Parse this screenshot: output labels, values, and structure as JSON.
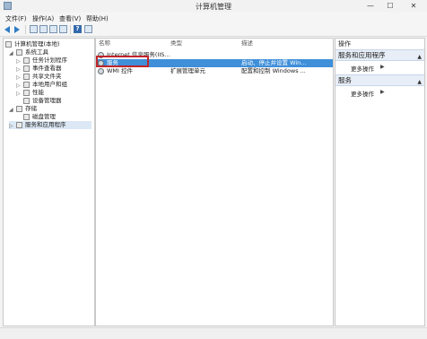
{
  "window": {
    "title": "计算机管理"
  },
  "window_controls": {
    "minimize": "—",
    "maximize": "☐",
    "close": "✕"
  },
  "menu": [
    "文件(F)",
    "操作(A)",
    "查看(V)",
    "帮助(H)"
  ],
  "tree": [
    {
      "label": "计算机管理(本地)",
      "indent": 0,
      "expander": ""
    },
    {
      "label": "系统工具",
      "indent": 1,
      "expander": "◢"
    },
    {
      "label": "任务计划程序",
      "indent": 2,
      "expander": "▷"
    },
    {
      "label": "事件查看器",
      "indent": 2,
      "expander": "▷"
    },
    {
      "label": "共享文件夹",
      "indent": 2,
      "expander": "▷"
    },
    {
      "label": "本地用户和组",
      "indent": 2,
      "expander": "▷"
    },
    {
      "label": "性能",
      "indent": 2,
      "expander": "▷"
    },
    {
      "label": "设备管理器",
      "indent": 2,
      "expander": ""
    },
    {
      "label": "存储",
      "indent": 1,
      "expander": "◢"
    },
    {
      "label": "磁盘管理",
      "indent": 2,
      "expander": ""
    },
    {
      "label": "服务和应用程序",
      "indent": 1,
      "expander": "▷"
    }
  ],
  "columns": [
    "名称",
    "类型",
    "描述"
  ],
  "rows": [
    {
      "name": "Internet 信息服务(IIS...",
      "type": "",
      "desc": ""
    },
    {
      "name": "服务",
      "type": "",
      "desc": "启动、停止并设置 Win...",
      "selected": true
    },
    {
      "name": "WMI 控件",
      "type": "扩展管理单元",
      "desc": "配置和控制 Windows ..."
    }
  ],
  "actions": {
    "header": "操作",
    "groups": [
      {
        "title": "服务和应用程序",
        "item": "更多操作"
      },
      {
        "title": "服务",
        "item": "更多操作"
      }
    ]
  },
  "colors": {
    "selection": "#3f8fd9",
    "highlight_box": "#c0252a",
    "accent": "#2e7cc4"
  }
}
